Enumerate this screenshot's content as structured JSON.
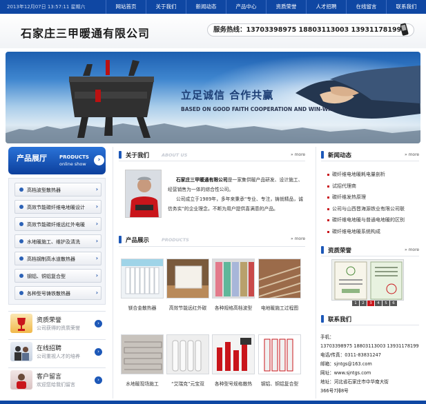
{
  "topbar": {
    "date": "2013年12月07日  13:57:11  星期六",
    "nav": [
      "网站首页",
      "关于我们",
      "新闻动态",
      "产品中心",
      "资质荣誉",
      "人才招聘",
      "在线留言",
      "联系我们"
    ]
  },
  "header": {
    "company": "石家庄三甲暖通有限公司",
    "hotline": "服务热线：13703398975   18803113003   13931178199"
  },
  "banner": {
    "headline": "立足诚信 合作共赢",
    "subline": "BASED ON GOOD FAITH COOPERATION AND WIN-WIN"
  },
  "left": {
    "products_title": "产品展厅",
    "products_en1": "PRODUCTS",
    "products_en2": "online show",
    "categories": [
      "高档波型散热器",
      "高效节能碳纤维电地暖设计",
      "高效节能碳纤维远红外电暖",
      "水地暖施工、维护及清洗",
      "高档钢制高水道散热器",
      "钢铝、铜铝复合型",
      "各种型号铸铁散热器"
    ],
    "boxes": [
      {
        "title": "资质荣誉",
        "sub": "公司获得的资质荣誉"
      },
      {
        "title": "在线招聘",
        "sub": "公司重视人才的培养"
      },
      {
        "title": "客户留言",
        "sub": "欢迎您给我们留言"
      }
    ]
  },
  "about": {
    "title": "关于我们",
    "en": "ABOUT US",
    "more": "more",
    "company": "石家庄三甲暖通有限公司",
    "para1": "是一家集供暖产品研发、设计施工、经营销售为一体的综合性公司。",
    "para2": "公司成立于1989年，多年来秉承“专业、专注，铸就精品，诚信务实”的企业理念，不断为用户提供喜满意的产品。"
  },
  "products": {
    "title": "产品展示",
    "en": "PRODUCTS",
    "more": "more",
    "items": [
      "镁合金散热器",
      "高效节能远红外碳",
      "各种规格高档波型",
      "电地暖施工过程图",
      "水地暖现场施工",
      "“艾瑞克”元宝双",
      "各种型号规格散热",
      "钢铝、铜铝复合型"
    ]
  },
  "news": {
    "title": "新闻动态",
    "more": "more",
    "items": [
      "碳纤维电地暖耗电量剖析",
      "试招代理商",
      "碳纤维发热原理",
      "公司与山西晋海源铁业有限公司联",
      "碳纤维电地暖与普通电地暖的区别",
      "碳纤维电地暖系统构成"
    ]
  },
  "honor": {
    "title": "资质荣誉",
    "more": "more",
    "pages": [
      "1",
      "2",
      "3",
      "4",
      "5",
      "6"
    ],
    "active_page": "3"
  },
  "contact": {
    "title": "联系我们",
    "lines": [
      "手机：",
      "13703398975   18803113003   13931178199",
      "电话/传真：0311-83831247",
      "邮箱：sjntgs@163.com",
      "网址：www.sjntgs.com",
      "地址：河北省石家庄市中华南大街",
      "366号7排8号"
    ]
  },
  "colors": {
    "brand_blue": "#0f47a3",
    "accent_red": "#c9151b"
  }
}
